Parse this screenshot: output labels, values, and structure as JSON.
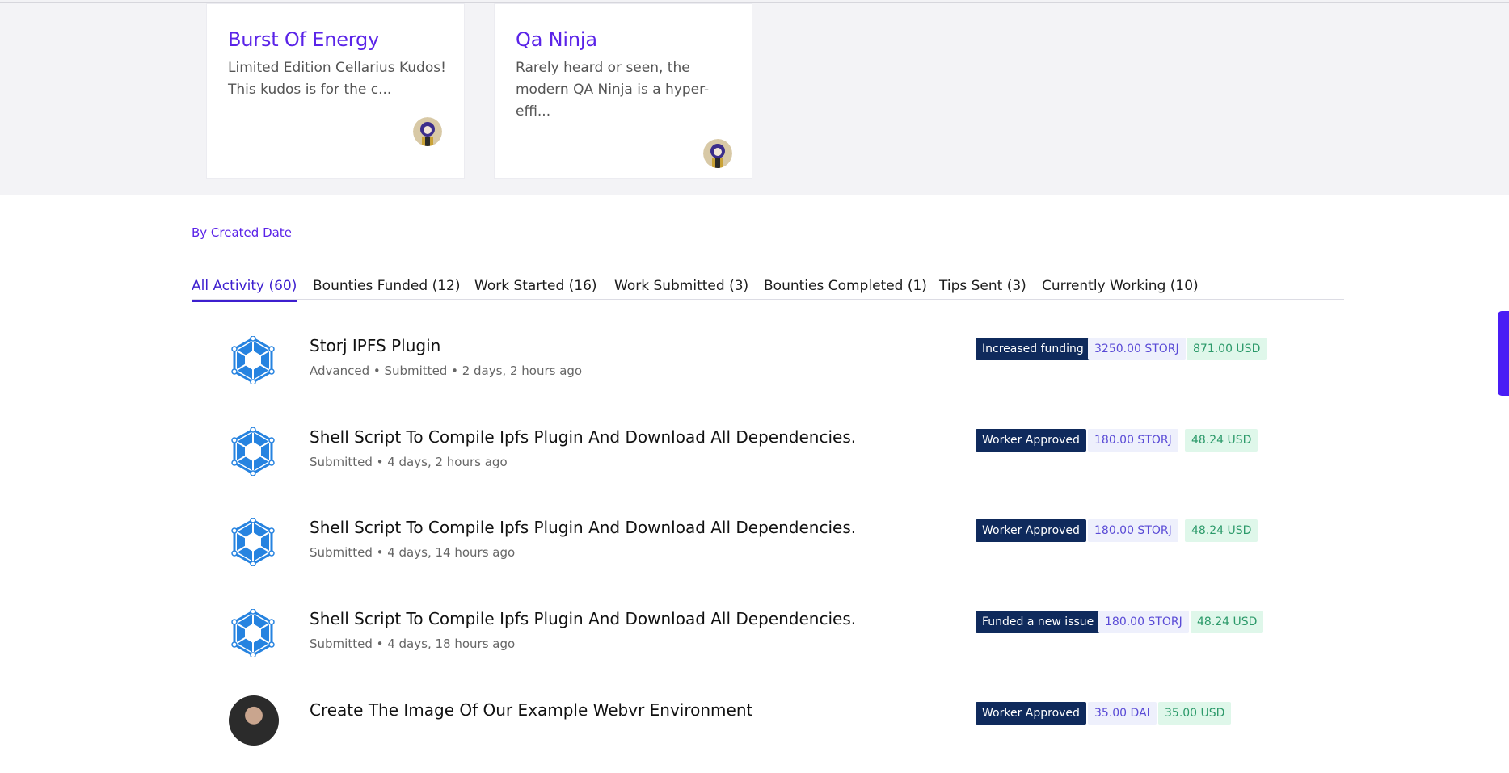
{
  "kudos": [
    {
      "title": "Burst Of Energy",
      "description": "Limited Edition Cellarius Kudos! This kudos is for the c..."
    },
    {
      "title": "Qa Ninja",
      "description": "Rarely heard or seen, the modern QA Ninja is a hyper-effi..."
    }
  ],
  "filter": {
    "label": "By Created Date"
  },
  "tabs": [
    {
      "label": "All Activity (60)"
    },
    {
      "label": "Bounties Funded (12)"
    },
    {
      "label": "Work Started (16)"
    },
    {
      "label": "Work Submitted (3)"
    },
    {
      "label": "Bounties Completed (1)"
    },
    {
      "label": "Tips Sent (3)"
    },
    {
      "label": "Currently Working (10)"
    }
  ],
  "activities": [
    {
      "icon": "storj-logo-icon",
      "title": "Storj IPFS Plugin",
      "meta": "Advanced • Submitted • 2 days, 2 hours ago",
      "event": "Increased funding",
      "token": "3250.00 STORJ",
      "usd": "871.00 USD"
    },
    {
      "icon": "storj-logo-icon",
      "title": "Shell Script To Compile Ipfs Plugin And Download All Dependencies.",
      "meta": "Submitted • 4 days, 2 hours ago",
      "event": "Worker Approved",
      "token": "180.00 STORJ",
      "usd": "48.24 USD"
    },
    {
      "icon": "storj-logo-icon",
      "title": "Shell Script To Compile Ipfs Plugin And Download All Dependencies.",
      "meta": "Submitted • 4 days, 14 hours ago",
      "event": "Worker Approved",
      "token": "180.00 STORJ",
      "usd": "48.24 USD"
    },
    {
      "icon": "storj-logo-icon",
      "title": "Shell Script To Compile Ipfs Plugin And Download All Dependencies.",
      "meta": "Submitted • 4 days, 18 hours ago",
      "event": "Funded a new issue",
      "token": "180.00 STORJ",
      "usd": "48.24 USD"
    },
    {
      "icon": "user-avatar",
      "title": "Create The Image Of Our Example Webvr Environment",
      "meta": "",
      "event": "Worker Approved",
      "token": "35.00 DAI",
      "usd": "35.00 USD"
    }
  ],
  "colors": {
    "accent": "#5a23e8",
    "dark_badge": "#0f2a5c",
    "storj_blue": "#2683e0"
  }
}
